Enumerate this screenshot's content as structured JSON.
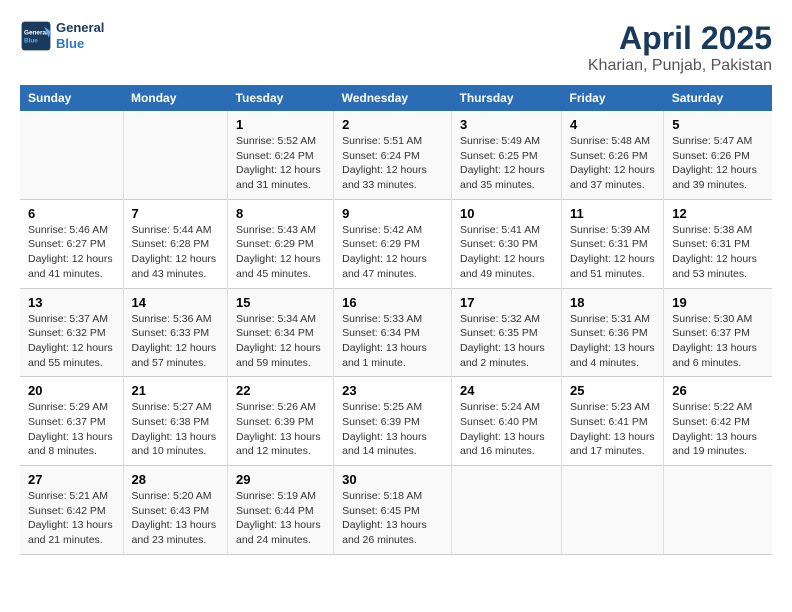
{
  "logo": {
    "line1": "General",
    "line2": "Blue"
  },
  "title": "April 2025",
  "subtitle": "Kharian, Punjab, Pakistan",
  "days_header": [
    "Sunday",
    "Monday",
    "Tuesday",
    "Wednesday",
    "Thursday",
    "Friday",
    "Saturday"
  ],
  "weeks": [
    [
      {
        "day": "",
        "sunrise": "",
        "sunset": "",
        "daylight": ""
      },
      {
        "day": "",
        "sunrise": "",
        "sunset": "",
        "daylight": ""
      },
      {
        "day": "1",
        "sunrise": "Sunrise: 5:52 AM",
        "sunset": "Sunset: 6:24 PM",
        "daylight": "Daylight: 12 hours and 31 minutes."
      },
      {
        "day": "2",
        "sunrise": "Sunrise: 5:51 AM",
        "sunset": "Sunset: 6:24 PM",
        "daylight": "Daylight: 12 hours and 33 minutes."
      },
      {
        "day": "3",
        "sunrise": "Sunrise: 5:49 AM",
        "sunset": "Sunset: 6:25 PM",
        "daylight": "Daylight: 12 hours and 35 minutes."
      },
      {
        "day": "4",
        "sunrise": "Sunrise: 5:48 AM",
        "sunset": "Sunset: 6:26 PM",
        "daylight": "Daylight: 12 hours and 37 minutes."
      },
      {
        "day": "5",
        "sunrise": "Sunrise: 5:47 AM",
        "sunset": "Sunset: 6:26 PM",
        "daylight": "Daylight: 12 hours and 39 minutes."
      }
    ],
    [
      {
        "day": "6",
        "sunrise": "Sunrise: 5:46 AM",
        "sunset": "Sunset: 6:27 PM",
        "daylight": "Daylight: 12 hours and 41 minutes."
      },
      {
        "day": "7",
        "sunrise": "Sunrise: 5:44 AM",
        "sunset": "Sunset: 6:28 PM",
        "daylight": "Daylight: 12 hours and 43 minutes."
      },
      {
        "day": "8",
        "sunrise": "Sunrise: 5:43 AM",
        "sunset": "Sunset: 6:29 PM",
        "daylight": "Daylight: 12 hours and 45 minutes."
      },
      {
        "day": "9",
        "sunrise": "Sunrise: 5:42 AM",
        "sunset": "Sunset: 6:29 PM",
        "daylight": "Daylight: 12 hours and 47 minutes."
      },
      {
        "day": "10",
        "sunrise": "Sunrise: 5:41 AM",
        "sunset": "Sunset: 6:30 PM",
        "daylight": "Daylight: 12 hours and 49 minutes."
      },
      {
        "day": "11",
        "sunrise": "Sunrise: 5:39 AM",
        "sunset": "Sunset: 6:31 PM",
        "daylight": "Daylight: 12 hours and 51 minutes."
      },
      {
        "day": "12",
        "sunrise": "Sunrise: 5:38 AM",
        "sunset": "Sunset: 6:31 PM",
        "daylight": "Daylight: 12 hours and 53 minutes."
      }
    ],
    [
      {
        "day": "13",
        "sunrise": "Sunrise: 5:37 AM",
        "sunset": "Sunset: 6:32 PM",
        "daylight": "Daylight: 12 hours and 55 minutes."
      },
      {
        "day": "14",
        "sunrise": "Sunrise: 5:36 AM",
        "sunset": "Sunset: 6:33 PM",
        "daylight": "Daylight: 12 hours and 57 minutes."
      },
      {
        "day": "15",
        "sunrise": "Sunrise: 5:34 AM",
        "sunset": "Sunset: 6:34 PM",
        "daylight": "Daylight: 12 hours and 59 minutes."
      },
      {
        "day": "16",
        "sunrise": "Sunrise: 5:33 AM",
        "sunset": "Sunset: 6:34 PM",
        "daylight": "Daylight: 13 hours and 1 minute."
      },
      {
        "day": "17",
        "sunrise": "Sunrise: 5:32 AM",
        "sunset": "Sunset: 6:35 PM",
        "daylight": "Daylight: 13 hours and 2 minutes."
      },
      {
        "day": "18",
        "sunrise": "Sunrise: 5:31 AM",
        "sunset": "Sunset: 6:36 PM",
        "daylight": "Daylight: 13 hours and 4 minutes."
      },
      {
        "day": "19",
        "sunrise": "Sunrise: 5:30 AM",
        "sunset": "Sunset: 6:37 PM",
        "daylight": "Daylight: 13 hours and 6 minutes."
      }
    ],
    [
      {
        "day": "20",
        "sunrise": "Sunrise: 5:29 AM",
        "sunset": "Sunset: 6:37 PM",
        "daylight": "Daylight: 13 hours and 8 minutes."
      },
      {
        "day": "21",
        "sunrise": "Sunrise: 5:27 AM",
        "sunset": "Sunset: 6:38 PM",
        "daylight": "Daylight: 13 hours and 10 minutes."
      },
      {
        "day": "22",
        "sunrise": "Sunrise: 5:26 AM",
        "sunset": "Sunset: 6:39 PM",
        "daylight": "Daylight: 13 hours and 12 minutes."
      },
      {
        "day": "23",
        "sunrise": "Sunrise: 5:25 AM",
        "sunset": "Sunset: 6:39 PM",
        "daylight": "Daylight: 13 hours and 14 minutes."
      },
      {
        "day": "24",
        "sunrise": "Sunrise: 5:24 AM",
        "sunset": "Sunset: 6:40 PM",
        "daylight": "Daylight: 13 hours and 16 minutes."
      },
      {
        "day": "25",
        "sunrise": "Sunrise: 5:23 AM",
        "sunset": "Sunset: 6:41 PM",
        "daylight": "Daylight: 13 hours and 17 minutes."
      },
      {
        "day": "26",
        "sunrise": "Sunrise: 5:22 AM",
        "sunset": "Sunset: 6:42 PM",
        "daylight": "Daylight: 13 hours and 19 minutes."
      }
    ],
    [
      {
        "day": "27",
        "sunrise": "Sunrise: 5:21 AM",
        "sunset": "Sunset: 6:42 PM",
        "daylight": "Daylight: 13 hours and 21 minutes."
      },
      {
        "day": "28",
        "sunrise": "Sunrise: 5:20 AM",
        "sunset": "Sunset: 6:43 PM",
        "daylight": "Daylight: 13 hours and 23 minutes."
      },
      {
        "day": "29",
        "sunrise": "Sunrise: 5:19 AM",
        "sunset": "Sunset: 6:44 PM",
        "daylight": "Daylight: 13 hours and 24 minutes."
      },
      {
        "day": "30",
        "sunrise": "Sunrise: 5:18 AM",
        "sunset": "Sunset: 6:45 PM",
        "daylight": "Daylight: 13 hours and 26 minutes."
      },
      {
        "day": "",
        "sunrise": "",
        "sunset": "",
        "daylight": ""
      },
      {
        "day": "",
        "sunrise": "",
        "sunset": "",
        "daylight": ""
      },
      {
        "day": "",
        "sunrise": "",
        "sunset": "",
        "daylight": ""
      }
    ]
  ]
}
